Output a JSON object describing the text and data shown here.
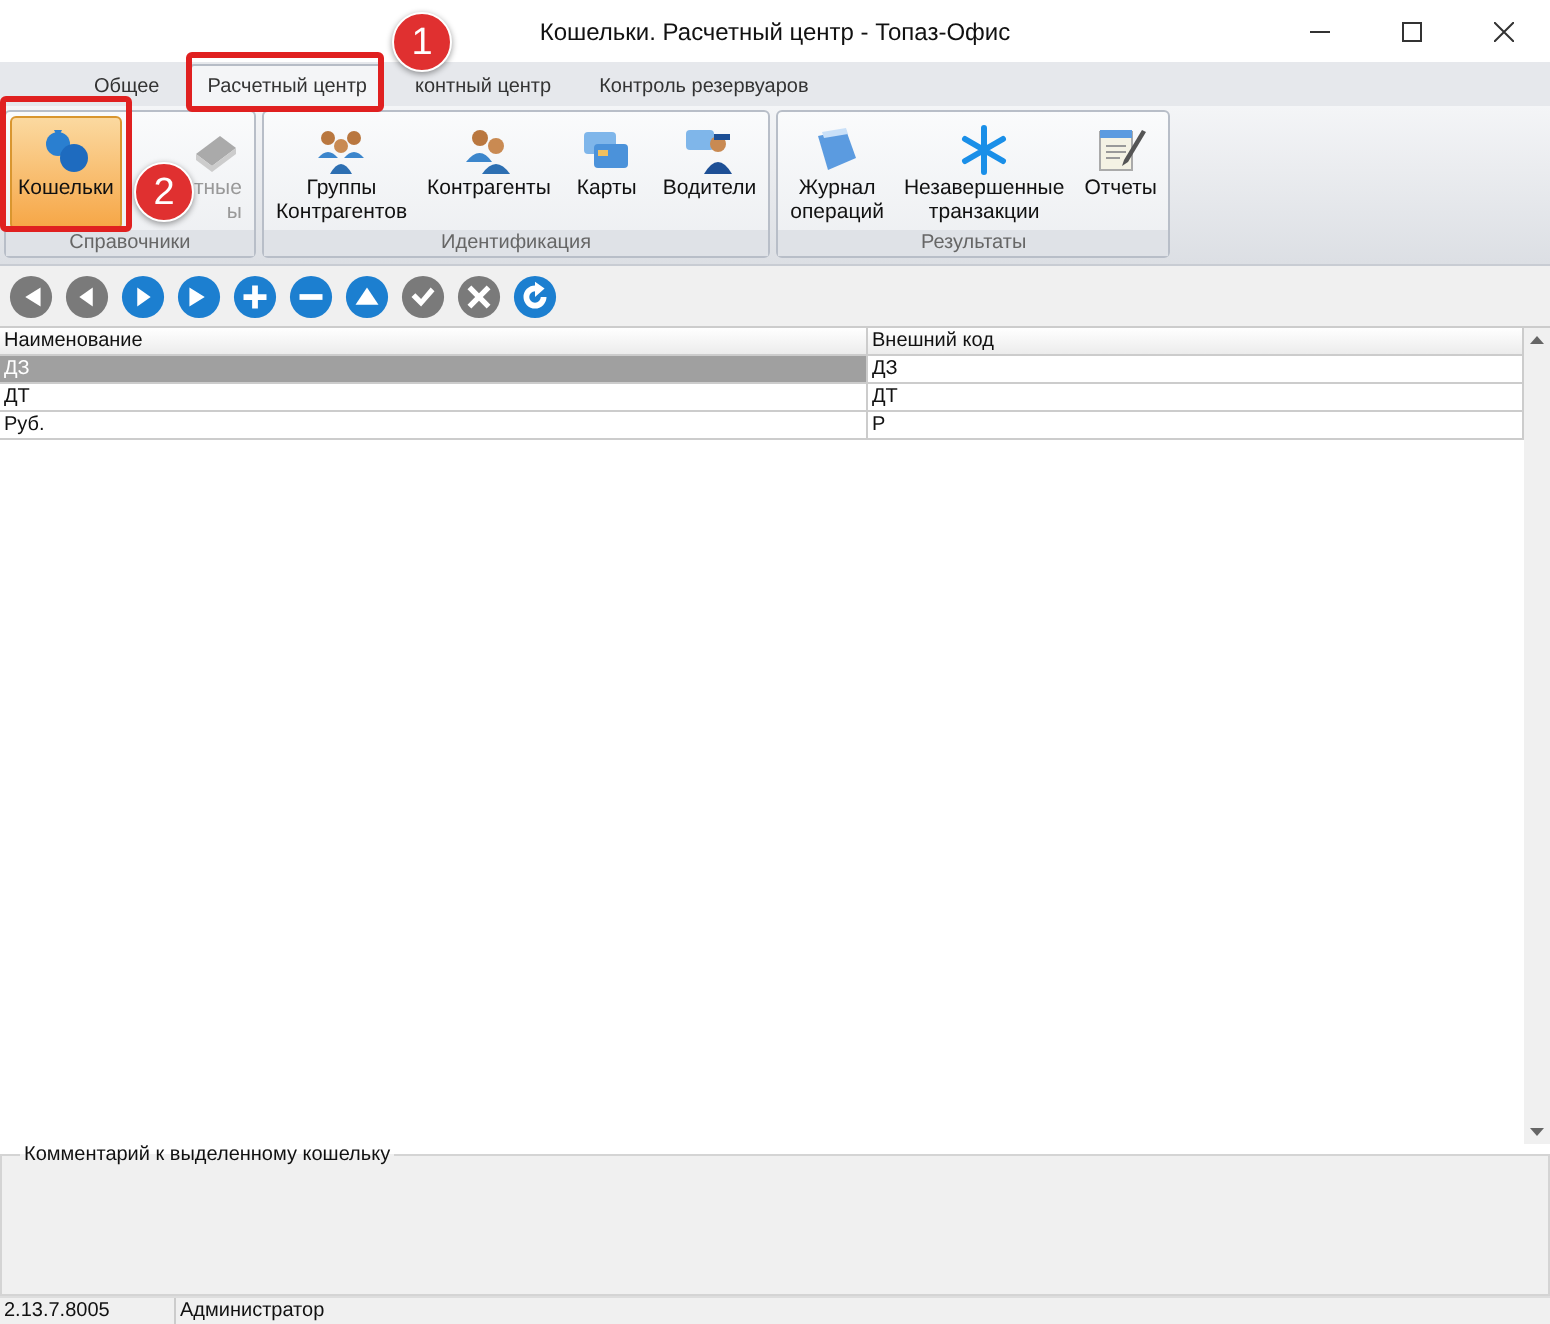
{
  "window": {
    "title": "Кошельки. Расчетный центр - Топаз-Офис"
  },
  "tabs": [
    {
      "label": "Общее",
      "selected": false
    },
    {
      "label": "Расчетный центр",
      "selected": true
    },
    {
      "label": "контный центр",
      "selected": false
    },
    {
      "label": "Контроль резервуаров",
      "selected": false
    }
  ],
  "ribbon_groups": [
    {
      "title": "Справочники",
      "buttons": [
        {
          "kind": "wallet",
          "lines": [
            "Кошельки"
          ],
          "selected": true,
          "disabled": false
        },
        {
          "kind": "ledger",
          "lines": [
            "тные",
            "ы"
          ],
          "selected": false,
          "disabled": true
        }
      ]
    },
    {
      "title": "Идентификация",
      "buttons": [
        {
          "kind": "group",
          "lines": [
            "Группы",
            "Контрагентов"
          ],
          "selected": false,
          "disabled": false
        },
        {
          "kind": "people",
          "lines": [
            "Контрагенты"
          ],
          "selected": false,
          "disabled": false
        },
        {
          "kind": "cards",
          "lines": [
            "Карты"
          ],
          "selected": false,
          "disabled": false
        },
        {
          "kind": "driver",
          "lines": [
            "Водители"
          ],
          "selected": false,
          "disabled": false
        }
      ]
    },
    {
      "title": "Результаты",
      "buttons": [
        {
          "kind": "journal",
          "lines": [
            "Журнал",
            "операций"
          ],
          "selected": false,
          "disabled": false
        },
        {
          "kind": "snowflake",
          "lines": [
            "Незавершенные",
            "транзакции"
          ],
          "selected": false,
          "disabled": false
        },
        {
          "kind": "report",
          "lines": [
            "Отчеты"
          ],
          "selected": false,
          "disabled": false
        }
      ]
    }
  ],
  "navigator": [
    {
      "kind": "first",
      "disabled": true
    },
    {
      "kind": "prior",
      "disabled": true
    },
    {
      "kind": "next",
      "disabled": false
    },
    {
      "kind": "last",
      "disabled": false
    },
    {
      "kind": "insert",
      "disabled": false
    },
    {
      "kind": "delete",
      "disabled": false
    },
    {
      "kind": "edit",
      "disabled": false
    },
    {
      "kind": "post",
      "disabled": true
    },
    {
      "kind": "cancel",
      "disabled": true
    },
    {
      "kind": "refresh",
      "disabled": false
    }
  ],
  "table": {
    "columns": [
      "Наименование",
      "Внешний код"
    ],
    "rows": [
      {
        "cells": [
          "ДЗ",
          "ДЗ"
        ],
        "selected": true
      },
      {
        "cells": [
          "ДТ",
          "ДТ"
        ],
        "selected": false
      },
      {
        "cells": [
          "Руб.",
          "Р"
        ],
        "selected": false
      }
    ]
  },
  "comment": {
    "title": "Комментарий к выделенному кошельку"
  },
  "status_bar": [
    "2.13.7.8005",
    "Администратор"
  ],
  "annotations": [
    {
      "number": "1"
    },
    {
      "number": "2"
    }
  ]
}
